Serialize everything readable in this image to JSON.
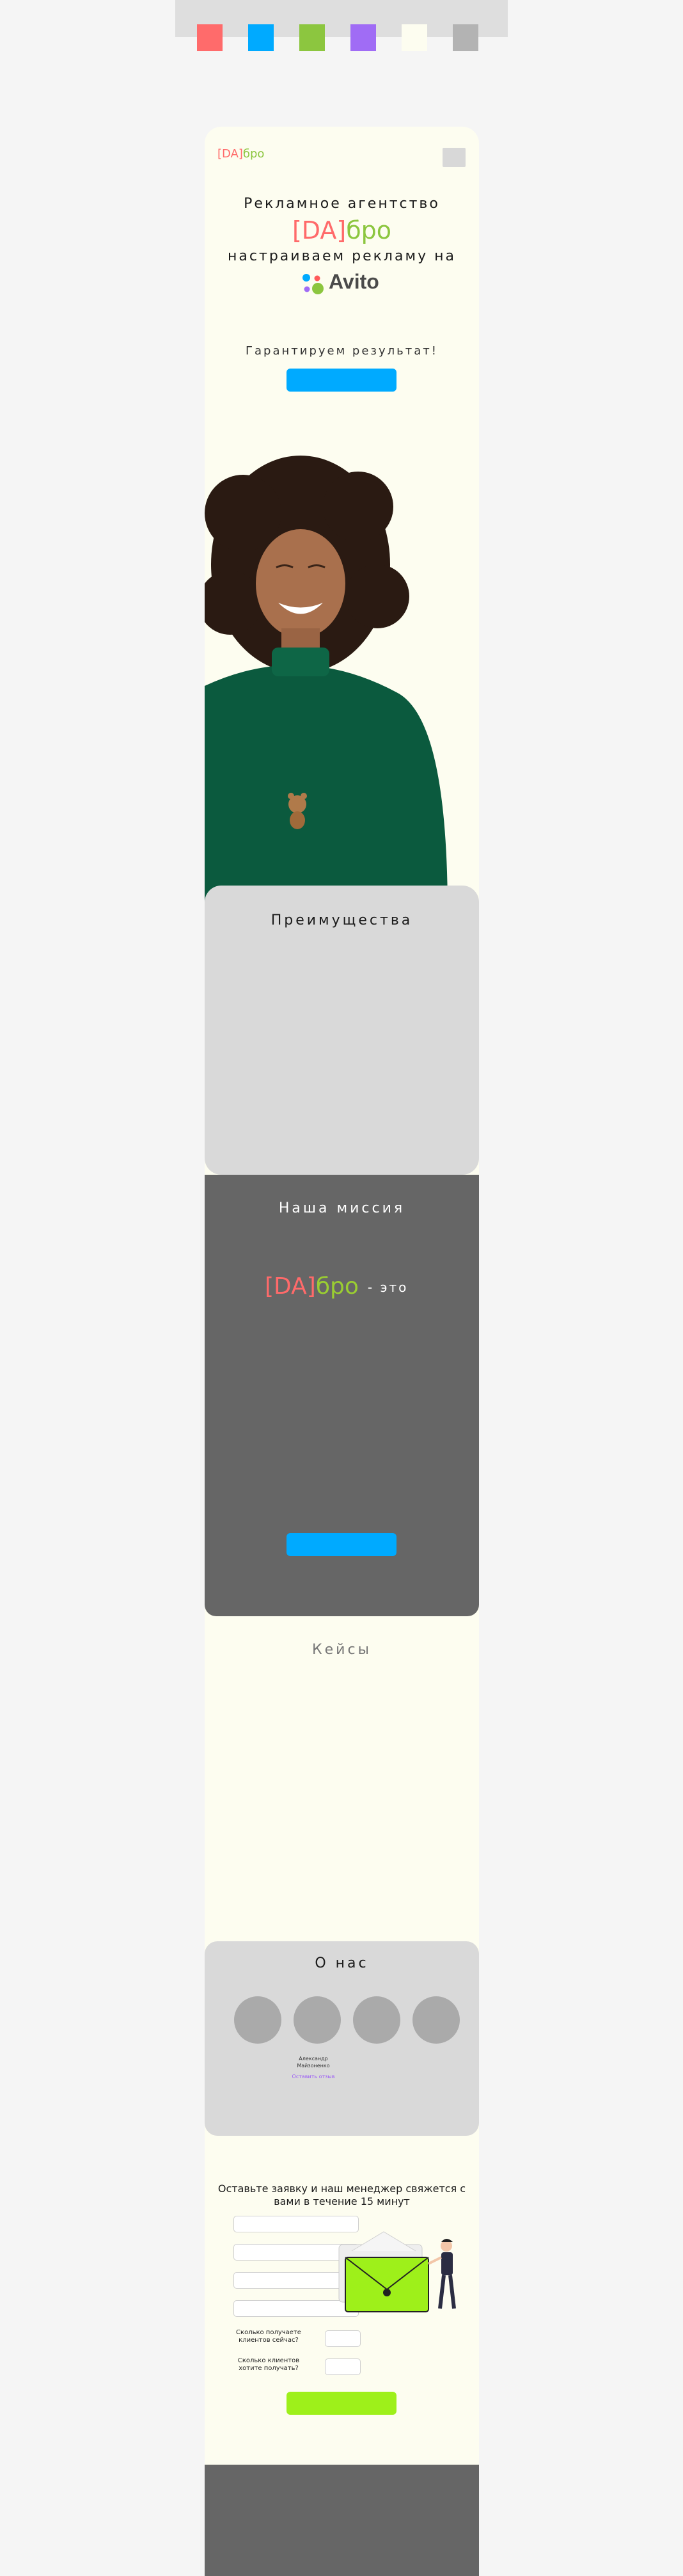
{
  "palette": {
    "colors": [
      "#ff6b6b",
      "#00aaff",
      "#8cc63f",
      "#a06cf5",
      "#fdfdf0",
      "#b3b3b3"
    ]
  },
  "header": {
    "logo_bracket": "[DA]",
    "logo_word": "бро"
  },
  "hero": {
    "line1": "Рекламное агентство",
    "brand_bracket": "[DA]",
    "brand_word": "бро",
    "line2": "настраиваем рекламу на",
    "avito_text": "Avito",
    "guarantee": "Гарантируем результат!"
  },
  "advantages": {
    "title": "Преимущества"
  },
  "mission": {
    "title": "Наша миссия",
    "brand_bracket": "[DA]",
    "brand_word": "бро",
    "dash_text": "- это"
  },
  "cases": {
    "title": "Кейсы"
  },
  "about": {
    "title": "О нас",
    "person_name": "Александр Майзоненко",
    "person_link": "Оставить отзыв"
  },
  "form": {
    "title": "Оставьте заявку и наш менеджер свяжется с вами в течение 15 минут",
    "q1": "Сколько получаете клиентов сейчас?",
    "q2": "Сколько клиентов хотите получать?"
  }
}
